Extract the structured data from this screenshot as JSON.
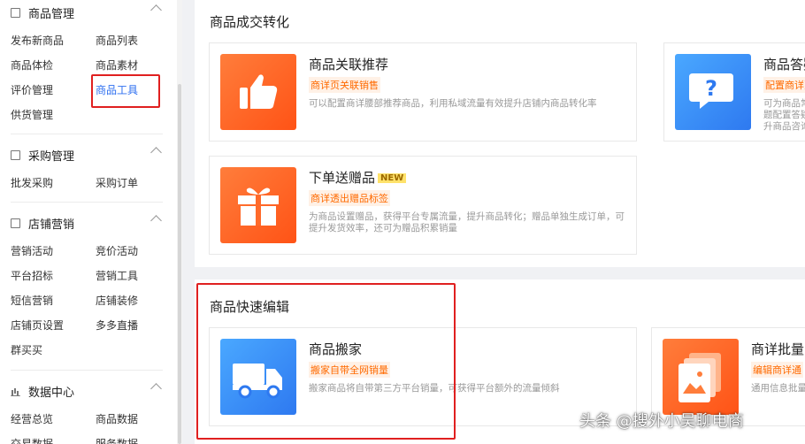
{
  "sidebar": {
    "goods": {
      "title": "商品管理",
      "items": [
        "发布新商品",
        "商品列表",
        "商品体检",
        "商品素材",
        "评价管理",
        "商品工具",
        "供货管理"
      ]
    },
    "purchase": {
      "title": "采购管理",
      "items": [
        "批发采购",
        "采购订单"
      ]
    },
    "marketing": {
      "title": "店铺营销",
      "items": [
        "营销活动",
        "竞价活动",
        "平台招标",
        "营销工具",
        "短信营销",
        "店铺装修",
        "店铺页设置",
        "多多直播",
        "群买买"
      ]
    },
    "data": {
      "title": "数据中心",
      "items": [
        "经营总览",
        "商品数据",
        "交易数据",
        "服务数据"
      ]
    }
  },
  "conversion": {
    "title": "商品成交转化",
    "cards": [
      {
        "name": "商品关联推荐",
        "tag": "商详页关联销售",
        "desc": "可以配置商详腰部推荐商品，利用私域流量有效提升店铺内商品转化率"
      },
      {
        "name": "商品答疑",
        "tag": "配置商详页",
        "desc": "可为商品常见问题配置答疑，提升商品咨询"
      },
      {
        "name": "下单送赠品",
        "badge": "NEW",
        "tag": "商详透出赠品标签",
        "desc": "为商品设置赠品，获得平台专属流量，提升商品转化；赠品单独生成订单，可提升发货效率，还可为赠品积累销量"
      }
    ]
  },
  "quickedit": {
    "title": "商品快速编辑",
    "cards": [
      {
        "name": "商品搬家",
        "tag": "搬家自带全网销量",
        "desc": "搬家商品将自带第三方平台销量，可获得平台额外的流量倾斜"
      },
      {
        "name": "商详批量",
        "tag": "编辑商详通",
        "desc": "通用信息批量"
      }
    ]
  },
  "watermark": "头条 @搜外小吴聊电商"
}
